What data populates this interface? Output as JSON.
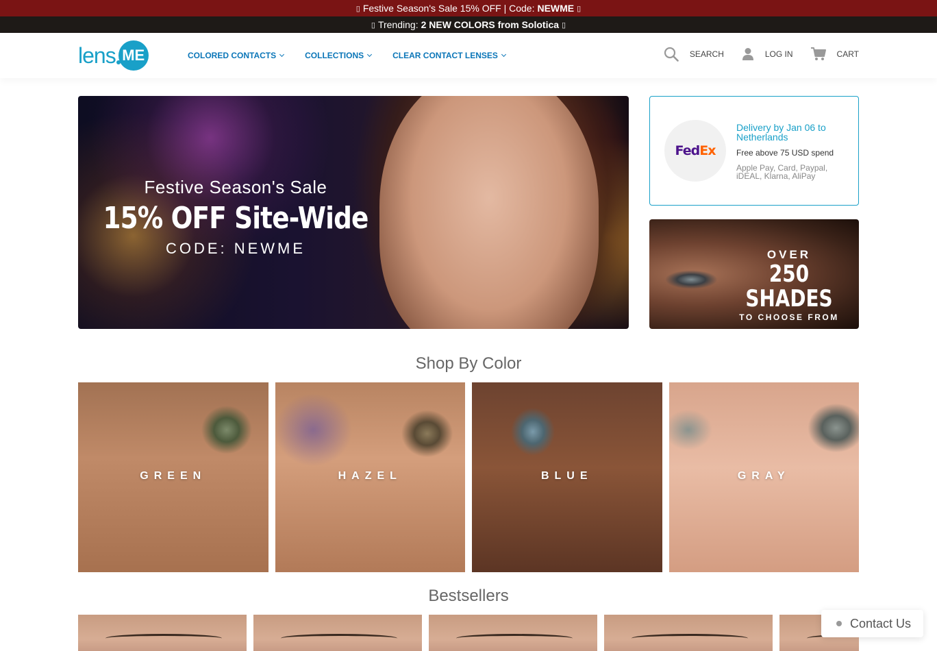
{
  "announcement": {
    "line1_text": "Festive Season's Sale 15% OFF | Code:",
    "line1_code": "NEWME",
    "line2_text": "Trending:",
    "line2_bold": "2 NEW COLORS from Solotica",
    "glyph": "▯"
  },
  "header": {
    "logo_text": "lens",
    "logo_me": "ME",
    "nav": [
      {
        "label": "COLORED CONTACTS"
      },
      {
        "label": "COLLECTIONS"
      },
      {
        "label": "CLEAR CONTACT LENSES"
      }
    ],
    "search_label": "SEARCH",
    "login_label": "LOG IN",
    "cart_label": "CART"
  },
  "hero": {
    "line1": "Festive Season's Sale",
    "line2": "15% OFF Site-Wide",
    "line3": "CODE: NEWME"
  },
  "delivery": {
    "carrier_fed": "Fed",
    "carrier_ex": "Ex",
    "title": "Delivery by Jan 06 to Netherlands",
    "free": "Free above 75 USD spend",
    "payments": "Apple Pay, Card, Paypal, iDEAL, Klarna, AliPay"
  },
  "shades_banner": {
    "line1": "OVER",
    "line2": "250 SHADES",
    "line3": "TO CHOOSE FROM"
  },
  "shop_by_color": {
    "title": "Shop By Color",
    "colors": [
      {
        "label": "GREEN"
      },
      {
        "label": "HAZEL"
      },
      {
        "label": "BLUE"
      },
      {
        "label": "GRAY"
      }
    ]
  },
  "bestsellers": {
    "title": "Bestsellers"
  },
  "contact": {
    "label": "Contact Us"
  },
  "colors": {
    "accent": "#19a0c8",
    "nav": "#0b76b8",
    "announcement_bg": "#7a1414",
    "trending_bg": "#1e1a17"
  },
  "icons": [
    "search-icon",
    "user-icon",
    "cart-icon",
    "chevron-down-icon",
    "status-dot-icon"
  ]
}
